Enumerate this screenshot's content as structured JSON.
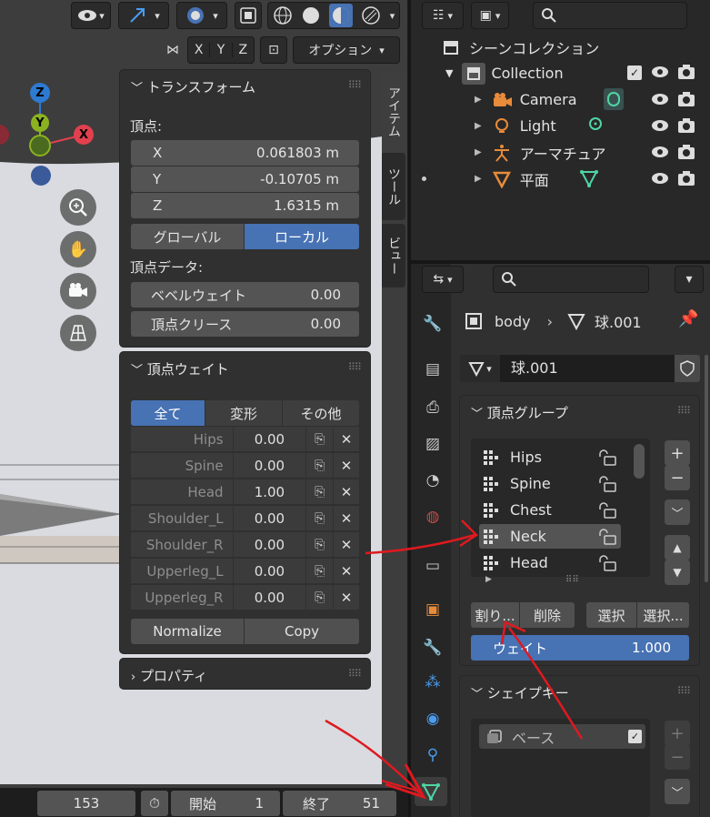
{
  "viewport": {
    "header": {
      "options_label": "オプション",
      "axis_x": "X",
      "axis_y": "Y",
      "axis_z": "Z"
    },
    "gizmo": {
      "z_label": "Z",
      "y_label": "Y",
      "x_label": "X"
    }
  },
  "n_panel": {
    "tabs": [
      "アイテム",
      "ツール",
      "ビュー"
    ],
    "transform": {
      "title": "トランスフォーム",
      "vertex_label": "頂点:",
      "x_label": "X",
      "x_value": "0.061803 m",
      "y_label": "Y",
      "y_value": "-0.10705 m",
      "z_label": "Z",
      "z_value": "1.6315 m",
      "global_label": "グローバル",
      "local_label": "ローカル",
      "vertex_data_label": "頂点データ:",
      "bevel_weight_label": "ベベルウェイト",
      "bevel_weight_value": "0.00",
      "crease_label": "頂点クリース",
      "crease_value": "0.00"
    },
    "vertex_weights": {
      "title": "頂点ウェイト",
      "filter_all": "全て",
      "filter_deform": "変形",
      "filter_other": "その他",
      "rows": [
        {
          "name": "Hips",
          "value": "0.00"
        },
        {
          "name": "Spine",
          "value": "0.00"
        },
        {
          "name": "Head",
          "value": "1.00"
        },
        {
          "name": "Shoulder_L",
          "value": "0.00"
        },
        {
          "name": "Shoulder_R",
          "value": "0.00"
        },
        {
          "name": "Upperleg_L",
          "value": "0.00"
        },
        {
          "name": "Upperleg_R",
          "value": "0.00"
        }
      ],
      "normalize_label": "Normalize",
      "copy_label": "Copy"
    },
    "properties_panel": {
      "title": "プロパティ"
    }
  },
  "timeline": {
    "current_frame": "153",
    "start_label": "開始",
    "start_value": "1",
    "end_label": "終了",
    "end_value": "51"
  },
  "outliner": {
    "scene_collection": "シーンコレクション",
    "collection": "Collection",
    "items": [
      {
        "name": "Camera"
      },
      {
        "name": "Light"
      },
      {
        "name": "アーマチュア"
      },
      {
        "name": "平面"
      }
    ]
  },
  "properties": {
    "breadcrumb_object": "body",
    "breadcrumb_mesh": "球.001",
    "mesh_name": "球.001",
    "vertex_groups": {
      "title": "頂点グループ",
      "items": [
        {
          "name": "Hips"
        },
        {
          "name": "Spine"
        },
        {
          "name": "Chest"
        },
        {
          "name": "Neck"
        },
        {
          "name": "Head"
        }
      ],
      "active": "Neck",
      "assign_label": "割り...",
      "remove_label": "削除",
      "select_label": "選択",
      "deselect_label": "選択...",
      "weight_label": "ウェイト",
      "weight_value": "1.000"
    },
    "shape_keys": {
      "title": "シェイプキー",
      "basis": "ベース"
    }
  },
  "colors": {
    "accent_blue": "#4772b3",
    "annotation_red": "#e0191f",
    "axis_x": "#e2404e",
    "axis_y": "#8bb320",
    "axis_z": "#2d7ad1",
    "mesh_green": "#4ed6a4"
  }
}
